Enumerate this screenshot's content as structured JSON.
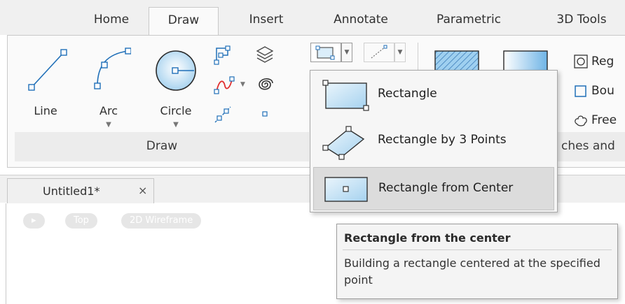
{
  "ribbon_tabs": [
    {
      "label": "Home",
      "active": false
    },
    {
      "label": "Draw",
      "active": true
    },
    {
      "label": "Insert",
      "active": false
    },
    {
      "label": "Annotate",
      "active": false
    },
    {
      "label": "Parametric",
      "active": false
    },
    {
      "label": "3D Tools",
      "active": false
    }
  ],
  "draw_panel": {
    "title": "Draw",
    "tools": {
      "line": {
        "label": "Line",
        "icon": "line-icon"
      },
      "arc": {
        "label": "Arc",
        "icon": "arc-icon"
      },
      "circle": {
        "label": "Circle",
        "icon": "circle-icon"
      }
    },
    "caret": "▼"
  },
  "next_panel": {
    "items": [
      {
        "label": "Reg",
        "icon": "region-icon"
      },
      {
        "label": "Bou",
        "icon": "boundary-icon"
      },
      {
        "label": "Free",
        "icon": "freeform-icon"
      }
    ],
    "title": "ches and"
  },
  "rectangle_menu": {
    "items": [
      {
        "label": "Rectangle",
        "icon": "rectangle-icon"
      },
      {
        "label": "Rectangle by 3 Points",
        "icon": "rectangle-3points-icon"
      },
      {
        "label": "Rectangle from Center",
        "icon": "rectangle-center-icon",
        "hovered": true
      }
    ]
  },
  "tooltip": {
    "title": "Rectangle from the center",
    "body": "Building a rectangle centered at the specified point"
  },
  "document_tab": {
    "title": "Untitled1*",
    "close": "×"
  },
  "viewport_controls": [
    {
      "label": "▸"
    },
    {
      "label": "Top"
    },
    {
      "label": "2D Wireframe"
    }
  ],
  "colors": {
    "accent_blue": "#1f6fb8",
    "icon_fill": "#cfe6f5",
    "red_spline": "#e03030"
  }
}
